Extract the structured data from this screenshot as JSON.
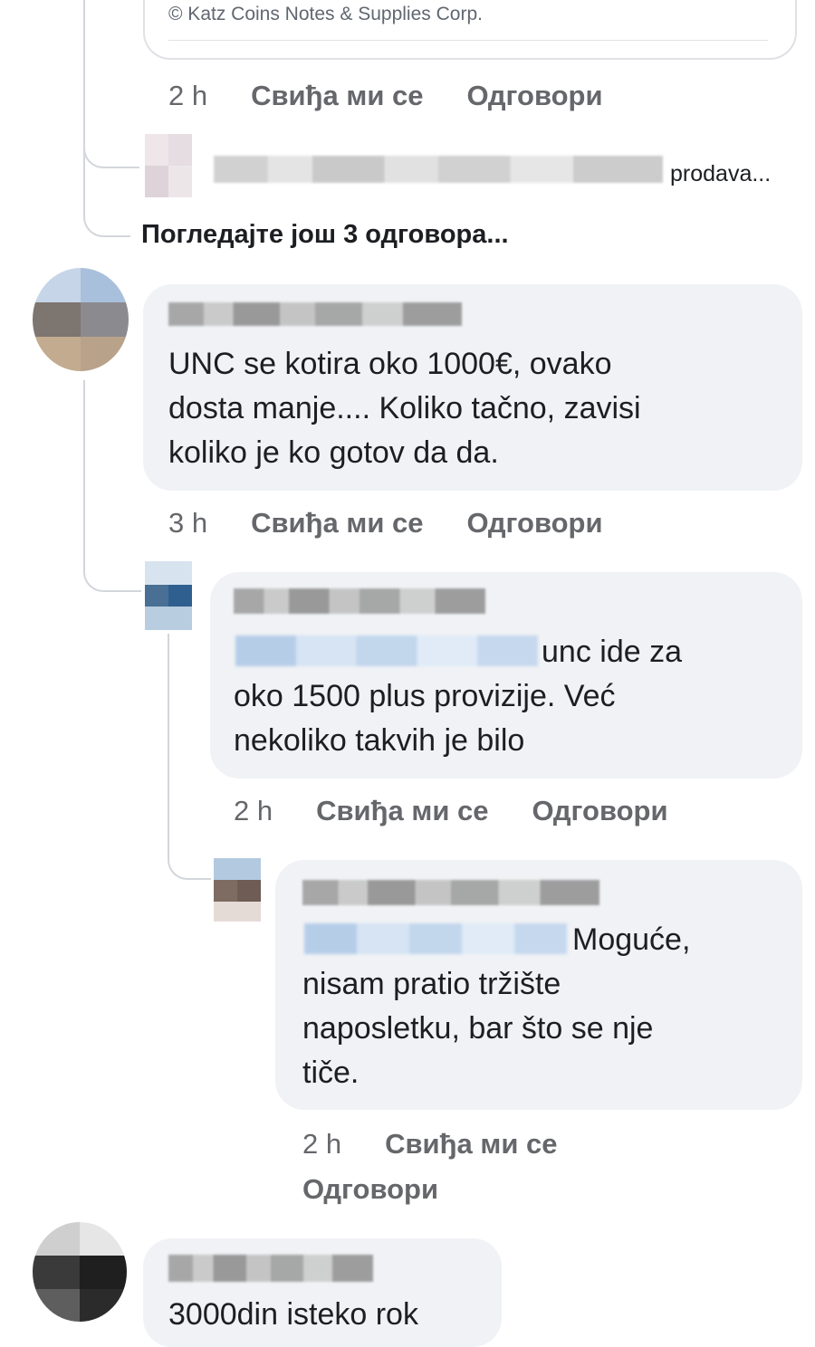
{
  "preview": {
    "source": "© Katz Coins Notes & Supplies Corp."
  },
  "comments": [
    {
      "time": "2 h",
      "like": "Свиђа ми се",
      "reply": "Одговори"
    },
    {
      "collapsed_preview": "prodava...",
      "view_more": "Погледајте још 3 одговора..."
    },
    {
      "lines": [
        "UNC se kotira oko 1000€, ovako",
        "dosta manje.... Koliko tačno, zavisi",
        "koliko je ko gotov da da."
      ],
      "time": "3 h",
      "like": "Свиђа ми се",
      "reply": "Одговори"
    },
    {
      "lines": [
        "unc ide za",
        "oko 1500 plus provizije. Već",
        "nekoliko takvih je bilo"
      ],
      "time": "2 h",
      "like": "Свиђа ми се",
      "reply": "Одговори"
    },
    {
      "lines": [
        "Moguće,",
        "nisam pratio tržište",
        "naposletku, bar što se nje",
        "tiče."
      ],
      "time": "2 h",
      "like": "Свиђа ми се",
      "reply": "Одговори"
    },
    {
      "lines": [
        "3000din isteko rok"
      ]
    }
  ],
  "colors": {
    "bubble": "#f0f2f5",
    "meta_text": "#65676b",
    "mention_blur": "#c2d6ec"
  }
}
